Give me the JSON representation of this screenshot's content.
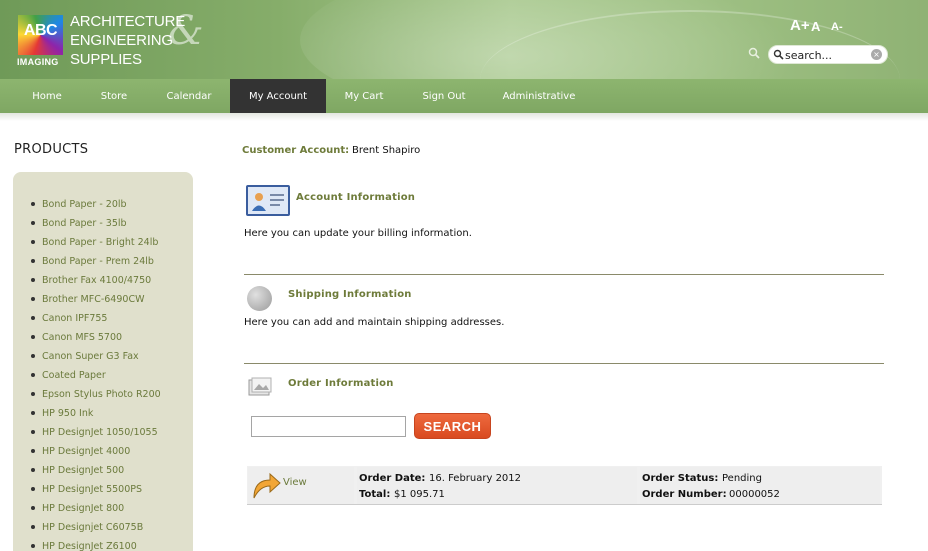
{
  "header": {
    "logo": {
      "abc": "ABC",
      "imaging": "IMAGING"
    },
    "brand_lines": [
      "ARCHITECTURE",
      "ENGINEERING",
      "SUPPLIES"
    ],
    "brand_amp": "&",
    "font_controls": [
      "A+",
      "A",
      "A-"
    ],
    "search": {
      "value": "search..."
    }
  },
  "nav": {
    "items": [
      {
        "label": "Home"
      },
      {
        "label": "Store"
      },
      {
        "label": "Calendar"
      },
      {
        "label": "My Account"
      },
      {
        "label": "My Cart"
      },
      {
        "label": "Sign Out"
      },
      {
        "label": "Administrative"
      }
    ],
    "active": "My Account"
  },
  "sidebar": {
    "title": "PRODUCTS",
    "items": [
      "Bond Paper - 20lb",
      "Bond Paper - 35lb",
      "Bond Paper - Bright 24lb",
      "Bond Paper - Prem 24lb",
      "Brother Fax 4100/4750",
      "Brother MFC-6490CW",
      "Canon IPF755",
      "Canon MFS 5700",
      "Canon Super G3 Fax",
      "Coated Paper",
      "Epson Stylus Photo R200",
      "HP 950 Ink",
      "HP DesignJet 1050/1055",
      "HP DesignJet 4000",
      "HP DesignJet 500",
      "HP DesignJet 5500PS",
      "HP DesignJet 800",
      "HP Designjet C6075B",
      "HP DesignJet Z6100"
    ]
  },
  "main": {
    "customer_label": "Customer Account:",
    "customer_name": "Brent Shapiro",
    "account": {
      "title": "Account Information",
      "desc": "Here you can update your billing information."
    },
    "shipping": {
      "title": "Shipping Information",
      "desc": "Here you can add and maintain shipping addresses."
    },
    "orders": {
      "title": "Order Information",
      "search_value": "",
      "search_button": "SEARCH",
      "rows": [
        {
          "view_label": "View",
          "date_label": "Order Date:",
          "date": "16. February 2012",
          "total_label": "Total:",
          "total": "$1 095.71",
          "status_label": "Order Status:",
          "status": "Pending",
          "number_label": "Order Number:",
          "number": "00000052"
        }
      ]
    }
  },
  "colors": {
    "header_green": "#86ad6a",
    "nav_green": "#8db56f",
    "nav_active": "#333333",
    "label_olive": "#6e7b3a",
    "sidebar_bg": "#e0e0cc",
    "search_button": "#e45a2f"
  }
}
